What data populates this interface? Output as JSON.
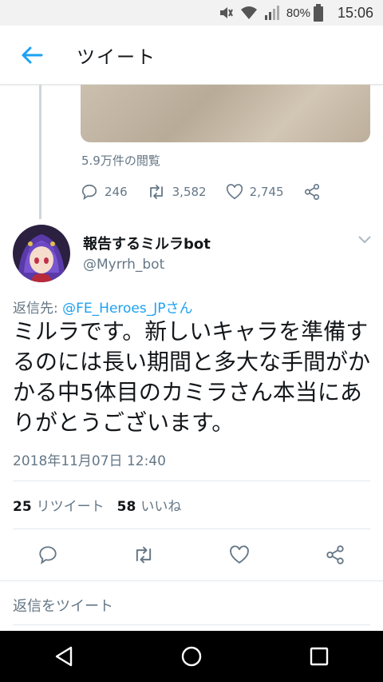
{
  "status_bar": {
    "battery": "80%",
    "time": "15:06"
  },
  "header": {
    "title": "ツイート"
  },
  "previous_tweet": {
    "views": "5.9万件の閲覧",
    "replies": "246",
    "retweets": "3,582",
    "likes": "2,745"
  },
  "tweet": {
    "display_name": "報告するミルラbot",
    "handle": "@Myrrh_bot",
    "reply_prefix": "返信先: ",
    "reply_mention": "@FE_Heroes_JPさん",
    "text": "ミルラです。新しいキャラを準備するのには長い期間と多大な手間がかかる中5体目のカミラさん本当にありがとうございます。",
    "timestamp": "2018年11月07日 12:40",
    "retweet_count": "25",
    "retweet_label": "リツイート",
    "like_count": "58",
    "like_label": "いいね"
  },
  "compose": {
    "placeholder": "返信をツイート"
  },
  "colors": {
    "accent": "#1da1f2",
    "muted": "#657786"
  }
}
